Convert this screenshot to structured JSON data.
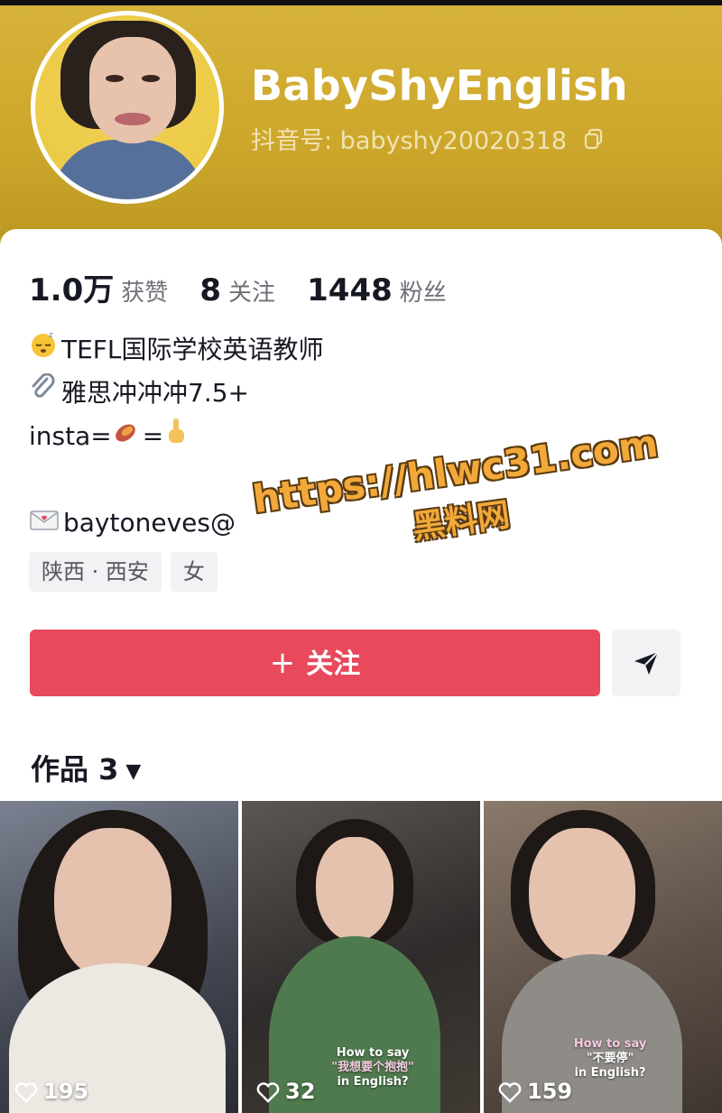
{
  "profile": {
    "name": "BabyShyEnglish",
    "douyin_id": "抖音号: babyshy20020318"
  },
  "stats": [
    {
      "value": "1.0万",
      "label": "获赞"
    },
    {
      "value": "8",
      "label": "关注"
    },
    {
      "value": "1448",
      "label": "粉丝"
    }
  ],
  "bio": {
    "line1": "TEFL国际学校英语教师",
    "line2": "雅思冲冲冲7.5+",
    "line3_prefix": "insta=",
    "line3_mid": "=",
    "email": "baytoneves@"
  },
  "tags": [
    "陕西 · 西安",
    "女"
  ],
  "actions": {
    "follow_label": "关注"
  },
  "works": {
    "label": "作品 3"
  },
  "videos": [
    {
      "likes": "195",
      "caption_line1": "",
      "caption_line2": "",
      "caption_line3": ""
    },
    {
      "likes": "32",
      "caption_line1": "How to say",
      "caption_line2": "\"我想要个抱抱\"",
      "caption_line3": "in English?"
    },
    {
      "likes": "159",
      "caption_line1": "How to say",
      "caption_line2": "\"不要停\"",
      "caption_line3": "in English?"
    }
  ],
  "watermark": {
    "url": "https://hlwc31.com",
    "name": "黑料网"
  },
  "colors": {
    "header": "#cda72b",
    "follow_button": "#e8495d"
  }
}
